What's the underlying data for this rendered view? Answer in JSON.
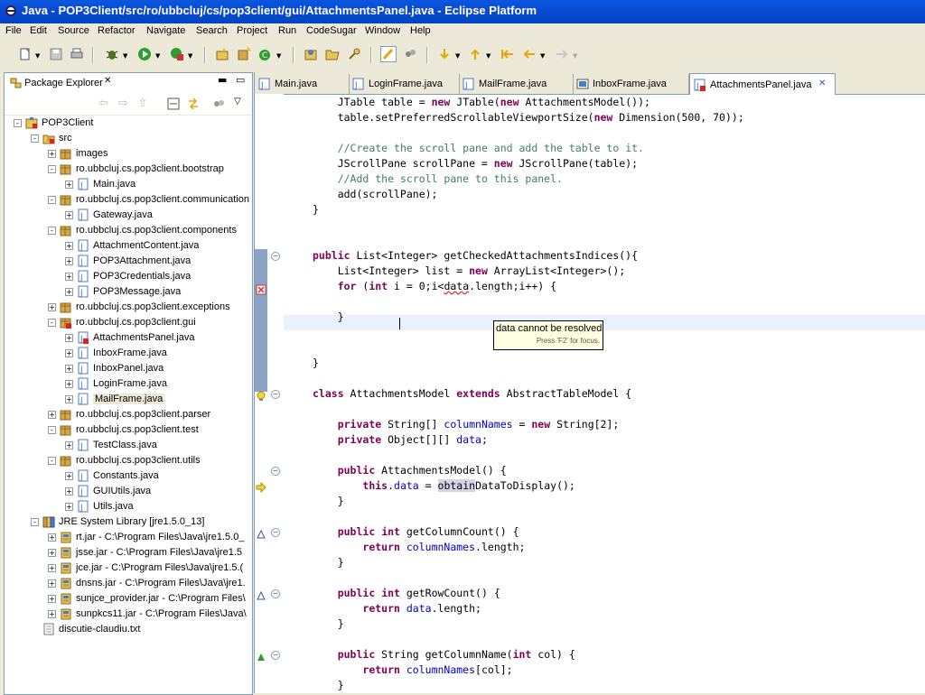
{
  "window": {
    "title": "Java - POP3Client/src/ro/ubbcluj/cs/pop3client/gui/AttachmentsPanel.java - Eclipse Platform"
  },
  "menu": [
    "File",
    "Edit",
    "Source",
    "Refactor",
    "Navigate",
    "Search",
    "Project",
    "Run",
    "CodeSugar",
    "Window",
    "Help"
  ],
  "package_explorer": {
    "title": "Package Explorer",
    "tree": [
      {
        "label": "POP3Client",
        "icon": "project-icon",
        "expand": "-"
      },
      {
        "label": "src",
        "icon": "source-folder-icon",
        "expand": "-"
      },
      {
        "label": "images",
        "icon": "package-icon",
        "expand": "+"
      },
      {
        "label": "ro.ubbcluj.cs.pop3client.bootstrap",
        "icon": "package-icon",
        "expand": "-"
      },
      {
        "label": "Main.java",
        "icon": "java-file-icon",
        "expand": "+"
      },
      {
        "label": "ro.ubbcluj.cs.pop3client.communication",
        "icon": "package-icon",
        "expand": "-"
      },
      {
        "label": "Gateway.java",
        "icon": "java-file-icon",
        "expand": "+"
      },
      {
        "label": "ro.ubbcluj.cs.pop3client.components",
        "icon": "package-icon",
        "expand": "-"
      },
      {
        "label": "AttachmentContent.java",
        "icon": "java-file-icon",
        "expand": "+"
      },
      {
        "label": "POP3Attachment.java",
        "icon": "java-file-icon",
        "expand": "+"
      },
      {
        "label": "POP3Credentials.java",
        "icon": "java-file-icon",
        "expand": "+"
      },
      {
        "label": "POP3Message.java",
        "icon": "java-file-icon",
        "expand": "+"
      },
      {
        "label": "ro.ubbcluj.cs.pop3client.exceptions",
        "icon": "package-icon",
        "expand": "+"
      },
      {
        "label": "ro.ubbcluj.cs.pop3client.gui",
        "icon": "package-error-icon",
        "expand": "-"
      },
      {
        "label": "AttachmentsPanel.java",
        "icon": "java-file-error-icon",
        "expand": "+"
      },
      {
        "label": "InboxFrame.java",
        "icon": "java-file-icon",
        "expand": "+"
      },
      {
        "label": "InboxPanel.java",
        "icon": "java-file-icon",
        "expand": "+"
      },
      {
        "label": "LoginFrame.java",
        "icon": "java-file-icon",
        "expand": "+"
      },
      {
        "label": "MailFrame.java",
        "icon": "java-file-icon",
        "expand": "+"
      },
      {
        "label": "ro.ubbcluj.cs.pop3client.parser",
        "icon": "package-icon",
        "expand": "+"
      },
      {
        "label": "ro.ubbcluj.cs.pop3client.test",
        "icon": "package-icon",
        "expand": "-"
      },
      {
        "label": "TestClass.java",
        "icon": "java-file-icon",
        "expand": "+"
      },
      {
        "label": "ro.ubbcluj.cs.pop3client.utils",
        "icon": "package-icon",
        "expand": "-"
      },
      {
        "label": "Constants.java",
        "icon": "java-file-icon",
        "expand": "+"
      },
      {
        "label": "GUIUtils.java",
        "icon": "java-file-icon",
        "expand": "+"
      },
      {
        "label": "Utils.java",
        "icon": "java-file-icon",
        "expand": "+"
      },
      {
        "label": "JRE System Library [jre1.5.0_13]",
        "icon": "library-icon",
        "expand": "-"
      },
      {
        "label": "rt.jar - C:\\Program Files\\Java\\jre1.5.0_",
        "icon": "jar-icon",
        "expand": "+"
      },
      {
        "label": "jsse.jar - C:\\Program Files\\Java\\jre1.5",
        "icon": "jar-icon",
        "expand": "+"
      },
      {
        "label": "jce.jar - C:\\Program Files\\Java\\jre1.5.(",
        "icon": "jar-icon",
        "expand": "+"
      },
      {
        "label": "dnsns.jar - C:\\Program Files\\Java\\jre1.",
        "icon": "jar-icon",
        "expand": "+"
      },
      {
        "label": "sunjce_provider.jar - C:\\Program Files\\",
        "icon": "jar-icon",
        "expand": "+"
      },
      {
        "label": "sunpkcs11.jar - C:\\Program Files\\Java\\",
        "icon": "jar-icon",
        "expand": "+"
      },
      {
        "label": "discutie-claudiu.txt",
        "icon": "text-file-icon",
        "expand": ""
      }
    ]
  },
  "editor": {
    "tabs": [
      {
        "label": "Main.java",
        "active": false
      },
      {
        "label": "LoginFrame.java",
        "active": false
      },
      {
        "label": "MailFrame.java",
        "active": false
      },
      {
        "label": "InboxFrame.java",
        "active": false
      },
      {
        "label": "AttachmentsPanel.java",
        "active": true
      }
    ],
    "code_lines": [
      "    JTable table = new JTable(new AttachmentsModel());",
      "    table.setPreferredScrollableViewportSize(new Dimension(500, 70));",
      "",
      "    //Create the scroll pane and add the table to it.",
      "    JScrollPane scrollPane = new JScrollPane(table);",
      "    //Add the scroll pane to this panel.",
      "    add(scrollPane);",
      "}",
      "",
      "",
      "public List<Integer> getCheckedAttachmentsIndices(){",
      "    List<Integer> list = new ArrayList<Integer>();",
      "    for (int i = 0;i<data.length;i++) {",
      "        ",
      "    }",
      "",
      "",
      "}",
      "",
      "class AttachmentsModel extends AbstractTableModel {",
      "",
      "    private String[] columnNames = new String[2];",
      "    private Object[][] data;",
      "",
      "    public AttachmentsModel() {",
      "        this.data = obtainDataToDisplay();",
      "    }",
      "",
      "    public int getColumnCount() {",
      "        return columnNames.length;",
      "    }",
      "",
      "    public int getRowCount() {",
      "        return data.length;",
      "    }",
      "",
      "    public String getColumnName(int col) {",
      "        return columnNames[col];",
      "    }"
    ],
    "tooltip": {
      "message": "data cannot be resolved",
      "hint": "Press 'F2' for focus."
    }
  }
}
